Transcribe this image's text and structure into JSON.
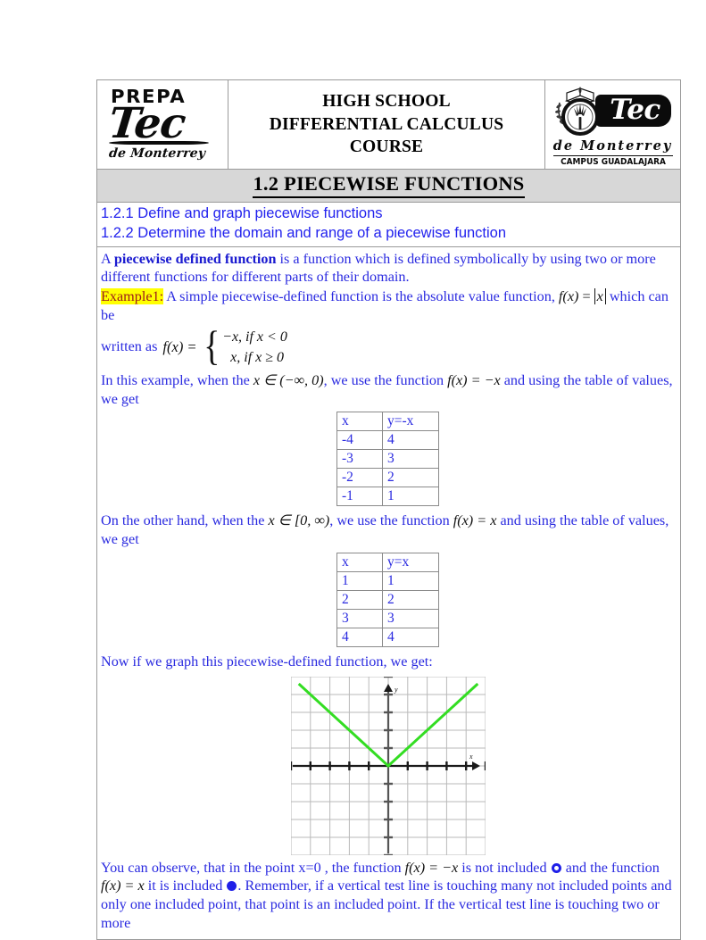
{
  "header": {
    "course_title_lines": [
      "HIGH SCHOOL",
      "DIFFERENTIAL CALCULUS",
      "COURSE"
    ],
    "logo_left": {
      "prepa": "PREPA",
      "tec": "Tec",
      "de_monterrey": "de Monterrey"
    },
    "logo_right": {
      "tec": "Tec",
      "de_monterrey": "de Monterrey",
      "campus": "CAMPUS GUADALAJARA"
    }
  },
  "section": {
    "title": "1.2 PIECEWISE FUNCTIONS"
  },
  "objectives": [
    "1.2.1 Define and graph piecewise functions",
    "1.2.2 Determine the domain and range of a piecewise function"
  ],
  "body": {
    "definition_pre": "A ",
    "definition_bold": "piecewise defined function",
    "definition_post": " is a function which is defined symbolically by using two or more different functions for different parts of their domain.",
    "example_label": "Example1:",
    "example_text_1": " A simple piecewise-defined function is the absolute value function, ",
    "example_math_1": "f(x) = |x|",
    "example_text_2": " which can be",
    "written_as": "written as",
    "piecewise_fx": "f(x) =",
    "piecewise_case_1": "−x, if  x < 0",
    "piecewise_case_2": "x, if  x ≥ 0",
    "para_neg_1": "In this example, when the ",
    "para_neg_math_domain": "x ∈ (−∞, 0)",
    "para_neg_2": ", we use the function ",
    "para_neg_math_fn": "f(x) = −x",
    "para_neg_3": " and using the table of  values, we get",
    "para_pos_1": "On the other hand, when the ",
    "para_pos_math_domain": "x ∈ [0, ∞)",
    "para_pos_2": ", we use the function ",
    "para_pos_math_fn": "f(x) = x",
    "para_pos_3": " and using the table of values, we get",
    "graph_intro": "Now if we graph this piecewise-defined function, we get:",
    "closing_1": "You can observe, that in the point x=0 , the function ",
    "closing_math_1": "f(x) = −x",
    "closing_2": " is not included ",
    "closing_3": " and the function ",
    "closing_math_2": "f(x) = x",
    "closing_4": " it is included ",
    "closing_5": ". Remember, if  a vertical test line is touching many not included points and only one included point, that point is an included point. If the vertical test line is touching two or more"
  },
  "table_negative": {
    "headers": [
      "x",
      "y=-x"
    ],
    "rows": [
      [
        "-4",
        "4"
      ],
      [
        "-3",
        "3"
      ],
      [
        "-2",
        "2"
      ],
      [
        "-1",
        "1"
      ]
    ]
  },
  "table_positive": {
    "headers": [
      "x",
      "y=x"
    ],
    "rows": [
      [
        "1",
        "1"
      ],
      [
        "2",
        "2"
      ],
      [
        "3",
        "3"
      ],
      [
        "4",
        "4"
      ]
    ]
  },
  "chart_data": {
    "type": "line",
    "title": "",
    "xlabel": "x",
    "ylabel": "y",
    "xlim": [
      -5,
      5
    ],
    "ylim": [
      -5,
      5
    ],
    "grid": true,
    "legend": false,
    "curve_color": "#33dd22",
    "axis_color": "#1a1a1a",
    "grid_color": "#b9b9b9",
    "series": [
      {
        "name": "f(x) = |x|",
        "x": [
          -4.6,
          0,
          4.6
        ],
        "y": [
          4.6,
          0,
          4.6
        ]
      }
    ]
  },
  "colors": {
    "body_text": "#2a2ae0",
    "objective_text": "#2222ee",
    "highlight": "#ffff00",
    "highlight_text": "#9b1b1b",
    "title_bar_bg": "#d7d7d7",
    "border": "#9a9a9a",
    "curve": "#33dd22"
  }
}
